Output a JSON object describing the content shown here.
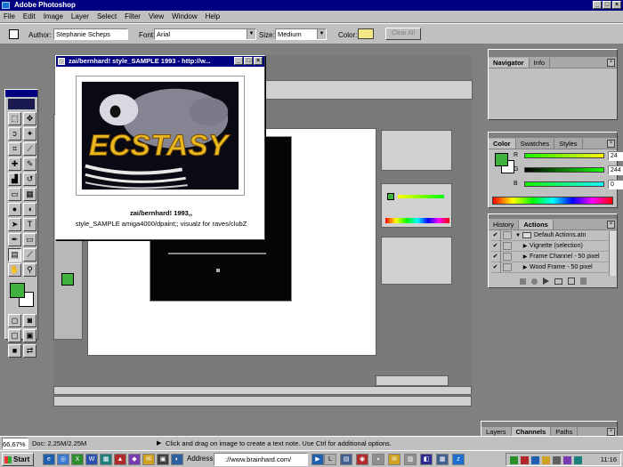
{
  "app": {
    "title": "Adobe Photoshop"
  },
  "menu": [
    "File",
    "Edit",
    "Image",
    "Layer",
    "Select",
    "Filter",
    "View",
    "Window",
    "Help"
  ],
  "options": {
    "author_label": "Author:",
    "author_value": "Stephanie Scheps",
    "font_label": "Font:",
    "font_value": "Arial",
    "size_label": "Size:",
    "size_value": "Medium",
    "color_label": "Color:",
    "clear_all": "Clear All"
  },
  "popup": {
    "title": "zai/bernhard! style_SAMPLE 1993 - http://w...",
    "artwork_text": "ECSTASY",
    "caption_line1": "zai/bernhard! 1993,,",
    "caption_line2": "style_SAMPLE amiga4000/dpaint;; visualz for raves/clubZ"
  },
  "navigator": {
    "tabs": [
      "Navigator",
      "Info"
    ]
  },
  "color_panel": {
    "tabs": [
      "Color",
      "Swatches",
      "Styles"
    ],
    "channels": [
      {
        "name": "R",
        "value": "24"
      },
      {
        "name": "G",
        "value": "244"
      },
      {
        "name": "B",
        "value": "0"
      }
    ]
  },
  "actions_panel": {
    "tabs": [
      "History",
      "Actions"
    ],
    "items": [
      {
        "label": "Default Actions.atn",
        "type": "set"
      },
      {
        "label": "Vignette (selection)",
        "type": "action"
      },
      {
        "label": "Frame Channel - 50 pixel",
        "type": "action"
      },
      {
        "label": "Wood Frame - 50 pixel",
        "type": "action"
      }
    ]
  },
  "layers_panel": {
    "tabs": [
      "Layers",
      "Channels",
      "Paths"
    ]
  },
  "status": {
    "zoom": "66.67%",
    "doc": "Doc: 2.25M/2.25M",
    "message": "Click and drag on image to create a text note. Use Ctrl for additional options."
  },
  "taskbar": {
    "start": "Start",
    "address_label": "Address",
    "address_value": "://www.brainhard.com/",
    "clock": "11:16"
  },
  "colors": {
    "titlebar": "#000080",
    "foreground": "#3fb23f",
    "annotation_color": "#f4e884"
  }
}
